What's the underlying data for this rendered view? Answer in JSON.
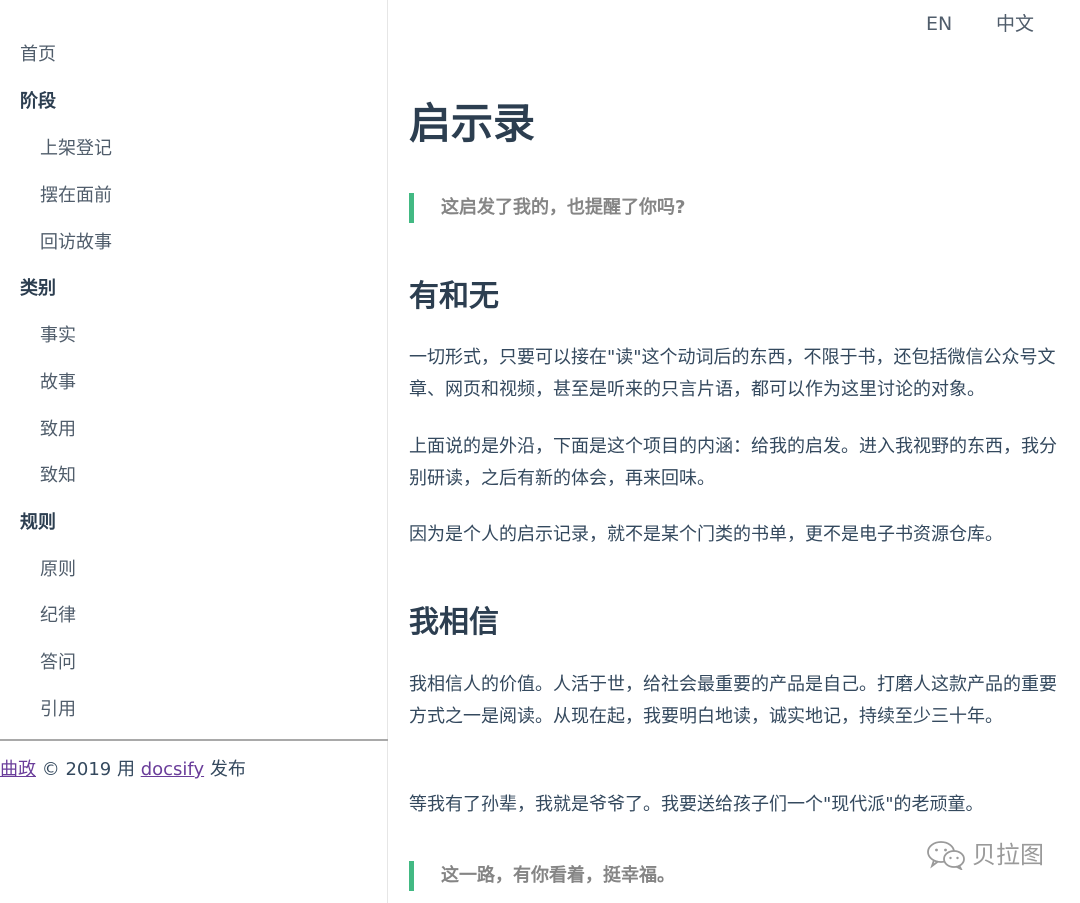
{
  "lang_links": {
    "en": "EN",
    "zh": "中文"
  },
  "sidebar": {
    "items": [
      {
        "label": "首页",
        "kind": "item"
      },
      {
        "label": "阶段",
        "kind": "section"
      },
      {
        "label": "上架登记",
        "kind": "child"
      },
      {
        "label": "摆在面前",
        "kind": "child"
      },
      {
        "label": "回访故事",
        "kind": "child"
      },
      {
        "label": "类别",
        "kind": "section"
      },
      {
        "label": "事实",
        "kind": "child"
      },
      {
        "label": "故事",
        "kind": "child"
      },
      {
        "label": "致用",
        "kind": "child"
      },
      {
        "label": "致知",
        "kind": "child"
      },
      {
        "label": "规则",
        "kind": "section"
      },
      {
        "label": "原则",
        "kind": "child"
      },
      {
        "label": "纪律",
        "kind": "child"
      },
      {
        "label": "答问",
        "kind": "child"
      },
      {
        "label": "引用",
        "kind": "child"
      }
    ]
  },
  "footer": {
    "author_link": "曲政",
    "copyright": " © 2019 用 ",
    "docsify_link": "docsify",
    "suffix": " 发布"
  },
  "content": {
    "title": "启示录",
    "quote_top": "这启发了我的，也提醒了你吗?",
    "section1": {
      "heading": "有和无",
      "p1": "一切形式，只要可以接在\"读\"这个动词后的东西，不限于书，还包括微信公众号文章、网页和视频，甚至是听来的只言片语，都可以作为这里讨论的对象。",
      "p2": "上面说的是外沿，下面是这个项目的内涵：给我的启发。进入我视野的东西，我分别研读，之后有新的体会，再来回味。",
      "p3": "因为是个人的启示记录，就不是某个门类的书单，更不是电子书资源仓库。"
    },
    "section2": {
      "heading": "我相信",
      "p1": "我相信人的价值。人活于世，给社会最重要的产品是自己。打磨人这款产品的重要方式之一是阅读。从现在起，我要明白地读，诚实地记，持续至少三十年。",
      "p2": "等我有了孙辈，我就是爷爷了。我要送给孩子们一个\"现代派\"的老顽童。"
    },
    "quote_bottom": "这一路，有你看着，挺幸福。"
  },
  "watermark": {
    "text": "贝拉图",
    "icon": "wechat-icon"
  },
  "colors": {
    "accent": "#42b983",
    "link_visited": "#6a3d9a",
    "heading": "#2c3e50"
  }
}
